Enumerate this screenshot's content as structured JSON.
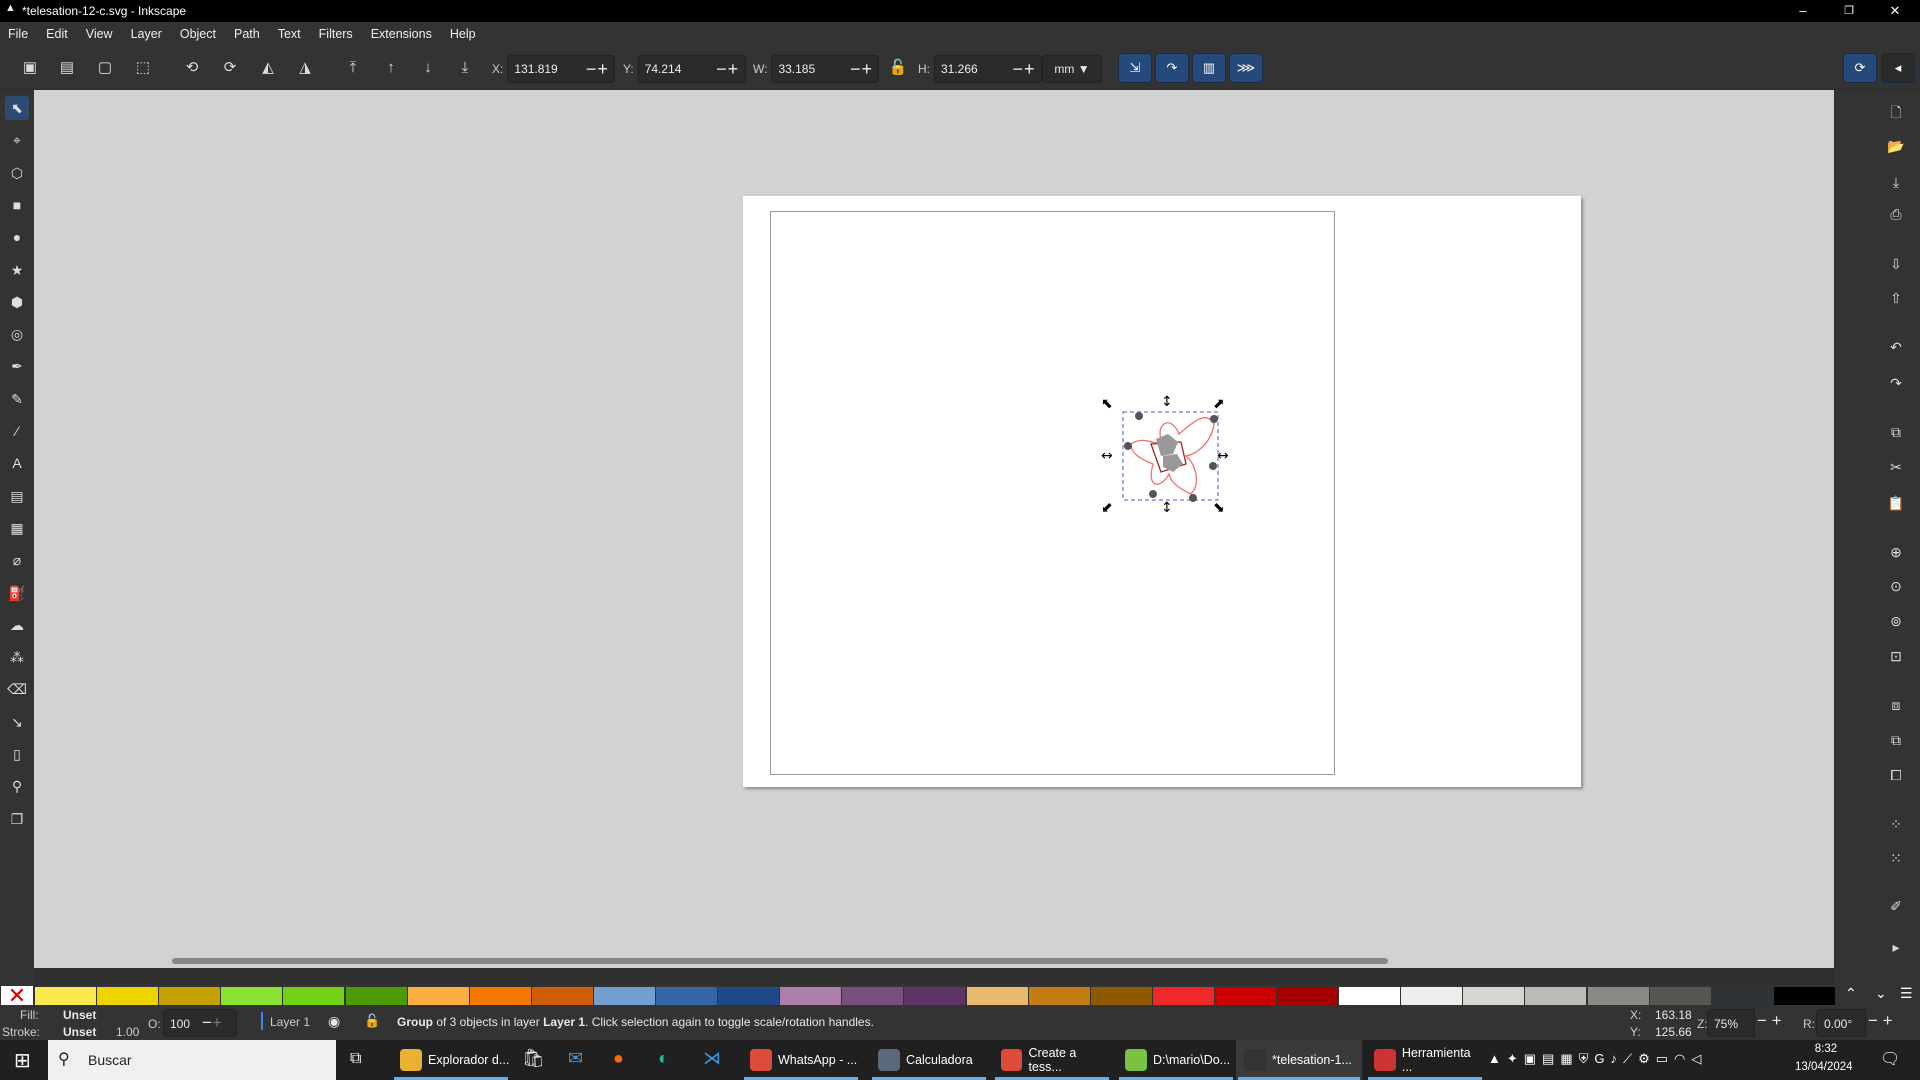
{
  "window": {
    "title": "*telesation-12-c.svg - Inkscape",
    "app_icon": "inkscape-icon",
    "minimize": "–",
    "maximize": "❐",
    "close": "✕"
  },
  "menu": [
    "File",
    "Edit",
    "View",
    "Layer",
    "Object",
    "Path",
    "Text",
    "Filters",
    "Extensions",
    "Help"
  ],
  "toolbar": {
    "icons": [
      "select-all-icon",
      "select-all-layers-icon",
      "deselect-icon",
      "select-same-icon",
      "rotate-ccw-icon",
      "rotate-cw-icon",
      "flip-horizontal-icon",
      "flip-vertical-icon",
      "raise-to-top-icon",
      "raise-icon",
      "lower-icon",
      "lower-to-bottom-icon"
    ],
    "x_label": "X:",
    "x": "131.819",
    "y_label": "Y:",
    "y": "74.214",
    "w_label": "W:",
    "w": "33.185",
    "h_label": "H:",
    "h": "31.266",
    "lock_icon": "unlock-icon",
    "unit": "mm",
    "transform_toggles": [
      "scale-stroke-icon",
      "scale-corners-icon",
      "move-gradients-icon",
      "move-patterns-icon"
    ],
    "snap_icon": "snap-icon"
  },
  "tools": [
    [
      "selector-icon",
      "⬉"
    ],
    [
      "node-icon",
      "⌖"
    ],
    [
      "shape-builder-icon",
      "⬡"
    ],
    [
      "rectangle-icon",
      "■"
    ],
    [
      "ellipse-icon",
      "●"
    ],
    [
      "star-icon",
      "★"
    ],
    [
      "box3d-icon",
      "⬢"
    ],
    [
      "spiral-icon",
      "◎"
    ],
    [
      "pen-icon",
      "✒"
    ],
    [
      "pencil-icon",
      "✎"
    ],
    [
      "calligraphy-icon",
      "⁄"
    ],
    [
      "text-icon",
      "A"
    ],
    [
      "gradient-icon",
      "▤"
    ],
    [
      "mesh-icon",
      "▦"
    ],
    [
      "dropper-icon",
      "⌀"
    ],
    [
      "paint-bucket-icon",
      "⛽"
    ],
    [
      "tweak-icon",
      "☁"
    ],
    [
      "spray-icon",
      "⁂"
    ],
    [
      "eraser-icon",
      "⌫"
    ],
    [
      "connector-icon",
      "↘"
    ],
    [
      "measure-icon",
      "▯"
    ],
    [
      "zoom-icon",
      "⚲"
    ],
    [
      "pages-icon",
      "❐"
    ]
  ],
  "commands": [
    [
      "new-document-icon",
      "🗋"
    ],
    [
      "open-icon",
      "📂"
    ],
    [
      "save-icon",
      "⤓"
    ],
    [
      "print-icon",
      "⎙"
    ],
    [
      "import-icon",
      "⇩"
    ],
    [
      "export-icon",
      "⇧"
    ],
    [
      "undo-icon",
      "↶"
    ],
    [
      "redo-icon",
      "↷"
    ],
    [
      "copy-icon",
      "⧉"
    ],
    [
      "cut-icon",
      "✂"
    ],
    [
      "paste-icon",
      "📋"
    ],
    [
      "zoom-selection-icon",
      "⊕"
    ],
    [
      "zoom-drawing-icon",
      "⊙"
    ],
    [
      "zoom-page-icon",
      "⊚"
    ],
    [
      "zoom-page-width-icon",
      "⊡"
    ],
    [
      "duplicate-icon",
      "⧈"
    ],
    [
      "clone-icon",
      "⧉"
    ],
    [
      "unlink-clone-icon",
      "⧠"
    ],
    [
      "group-icon",
      "⁘"
    ],
    [
      "ungroup-icon",
      "⁙"
    ],
    [
      "xml-editor-icon",
      "✐"
    ],
    [
      "more-icon",
      "▸"
    ]
  ],
  "palette": {
    "none_icon": "no-paint-icon",
    "colors": [
      "#fce94f",
      "#edd400",
      "#c4a000",
      "#8ae234",
      "#73d216",
      "#4e9a06",
      "#fcaf3e",
      "#f57900",
      "#ce5c00",
      "#729fcf",
      "#3465a4",
      "#204a87",
      "#ad7fa8",
      "#75507b",
      "#5c3566",
      "#e9b96e",
      "#c17d11",
      "#8f5902",
      "#ef2929",
      "#cc0000",
      "#a40000",
      "#ffffff",
      "#eeeeec",
      "#d3d7cf",
      "#babdb6",
      "#888a85",
      "#555753",
      "#2e3436",
      "#000000"
    ]
  },
  "status": {
    "fill_label": "Fill:",
    "fill": "Unset",
    "stroke_label": "Stroke:",
    "stroke": "Unset",
    "stroke_width": "1.00",
    "opacity_label": "O:",
    "opacity": "100",
    "layer": "Layer 1",
    "msg_bold1": "Group",
    "msg_mid": " of 3 objects in layer ",
    "msg_bold2": "Layer 1",
    "msg_end": ". Click selection again to toggle scale/rotation handles.",
    "cx_label": "X:",
    "cx": "163.18",
    "cy_label": "Y:",
    "cy": "125.66",
    "zoom_label": "Z:",
    "zoom": "75%",
    "rot_label": "R:",
    "rotation": "0.00°"
  },
  "taskbar": {
    "search": "Buscar",
    "items": [
      [
        "Explorador d...",
        "#e8b130",
        "file-explorer-icon",
        true,
        false
      ],
      [
        "Calculadora",
        "#5a6a7a",
        "calculator-icon",
        true,
        false
      ],
      [
        "WhatsApp - ...",
        "#dd4b39",
        "chrome-icon",
        true,
        false
      ],
      [
        "Create a tess...",
        "#dd4b39",
        "chrome-icon",
        true,
        false
      ],
      [
        "D:\\mario\\Do...",
        "#7cc242",
        "notepad-icon",
        true,
        false
      ],
      [
        "*telesation-1...",
        "#333",
        "inkscape-icon",
        true,
        true
      ],
      [
        "Herramienta ...",
        "#c33",
        "snipping-tool-icon",
        true,
        false
      ]
    ],
    "time": "8:32",
    "date": "13/04/2024"
  }
}
